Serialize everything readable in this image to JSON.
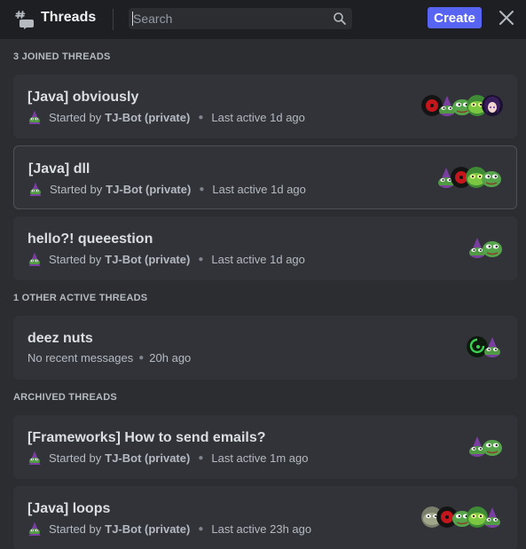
{
  "header": {
    "title": "Threads",
    "search_placeholder": "Search",
    "create_label": "Create"
  },
  "sections": [
    {
      "label": "3 JOINED THREADS"
    },
    {
      "label": "1 OTHER ACTIVE THREADS"
    },
    {
      "label": "ARCHIVED THREADS"
    }
  ],
  "threads": [
    {
      "title": "[Java] obviously",
      "prefix": "Started by",
      "starter": "TJ-Bot (private)",
      "activity": "Last active 1d ago"
    },
    {
      "title": "[Java] dll",
      "prefix": "Started by",
      "starter": "TJ-Bot (private)",
      "activity": "Last active 1d ago"
    },
    {
      "title": "hello?! queeestion",
      "prefix": "Started by",
      "starter": "TJ-Bot (private)",
      "activity": "Last active 1d ago"
    },
    {
      "title": "deez nuts",
      "message": "No recent messages",
      "time": "20h ago"
    },
    {
      "title": "[Frameworks] How to send emails?",
      "prefix": "Started by",
      "starter": "TJ-Bot (private)",
      "activity": "Last active 1m ago"
    },
    {
      "title": "[Java] loops",
      "prefix": "Started by",
      "starter": "TJ-Bot (private)",
      "activity": "Last active 23h ago"
    }
  ],
  "icons": {
    "header": "threads-icon",
    "search": "search-icon",
    "close": "close-icon",
    "bot_avatar": "wizard-frog-avatar"
  },
  "colors": {
    "accent": "#5865f2",
    "background": "#2b2d31",
    "card": "#313338",
    "header": "#1e1f22"
  }
}
